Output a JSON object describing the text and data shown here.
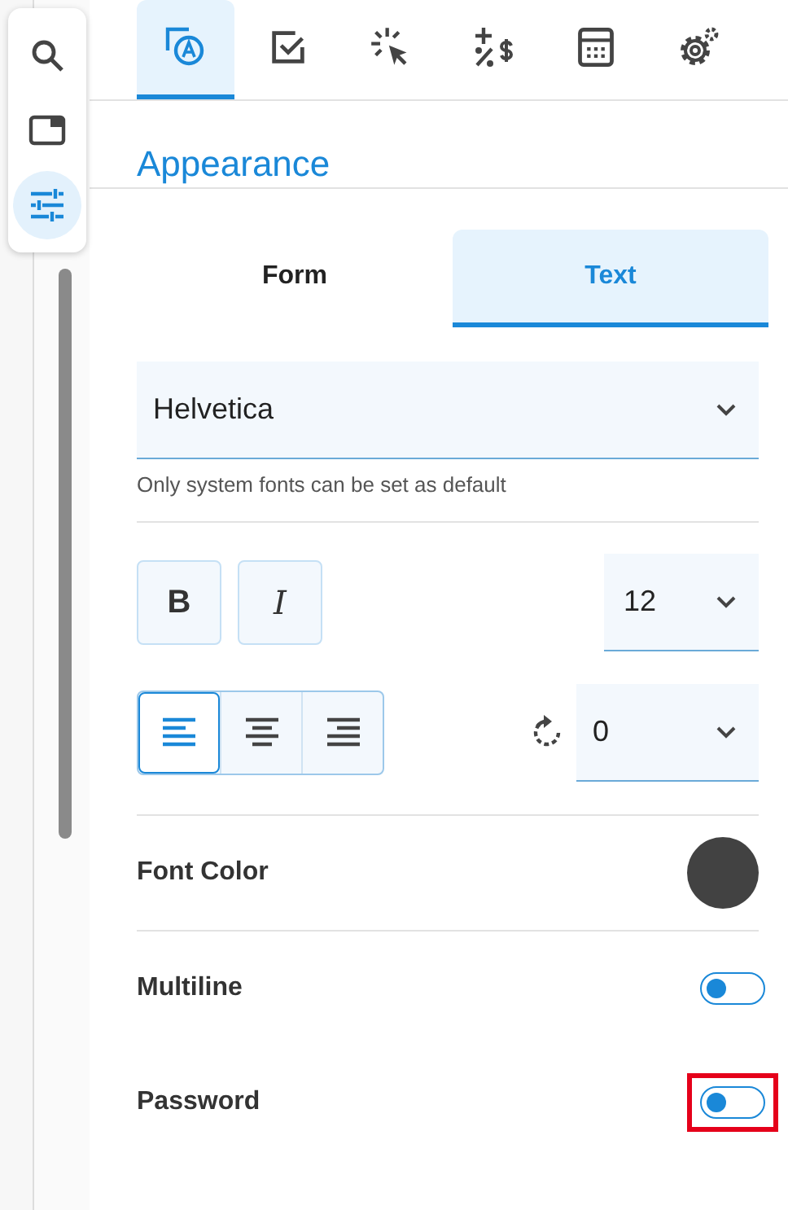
{
  "rail": {
    "tools": [
      {
        "kind": "search",
        "selected": false
      },
      {
        "kind": "panel",
        "selected": false
      },
      {
        "kind": "sliders",
        "selected": true
      }
    ]
  },
  "tabs": [
    {
      "kind": "appearance",
      "selected": true
    },
    {
      "kind": "check",
      "selected": false
    },
    {
      "kind": "click",
      "selected": false
    },
    {
      "kind": "calc",
      "selected": false
    },
    {
      "kind": "calculator",
      "selected": false
    },
    {
      "kind": "gears",
      "selected": false
    }
  ],
  "section_title": "Appearance",
  "mode_tabs": [
    {
      "label": "Form",
      "selected": false
    },
    {
      "label": "Text",
      "selected": true
    }
  ],
  "font": {
    "value": "Helvetica",
    "helper": "Only system fonts can be set as default"
  },
  "style_buttons": [
    {
      "label": "B",
      "kind": "bold",
      "on": false
    },
    {
      "label": "I",
      "kind": "italic",
      "on": false
    }
  ],
  "font_size": {
    "value": "12"
  },
  "align": [
    {
      "kind": "left",
      "selected": true
    },
    {
      "kind": "center",
      "selected": false
    },
    {
      "kind": "right",
      "selected": false
    }
  ],
  "rotation": {
    "value": "0"
  },
  "font_color": {
    "label": "Font Color",
    "color": "#424242"
  },
  "toggles": [
    {
      "label": "Multiline",
      "on": false,
      "highlighted": false
    },
    {
      "label": "Password",
      "on": false,
      "highlighted": true
    }
  ]
}
